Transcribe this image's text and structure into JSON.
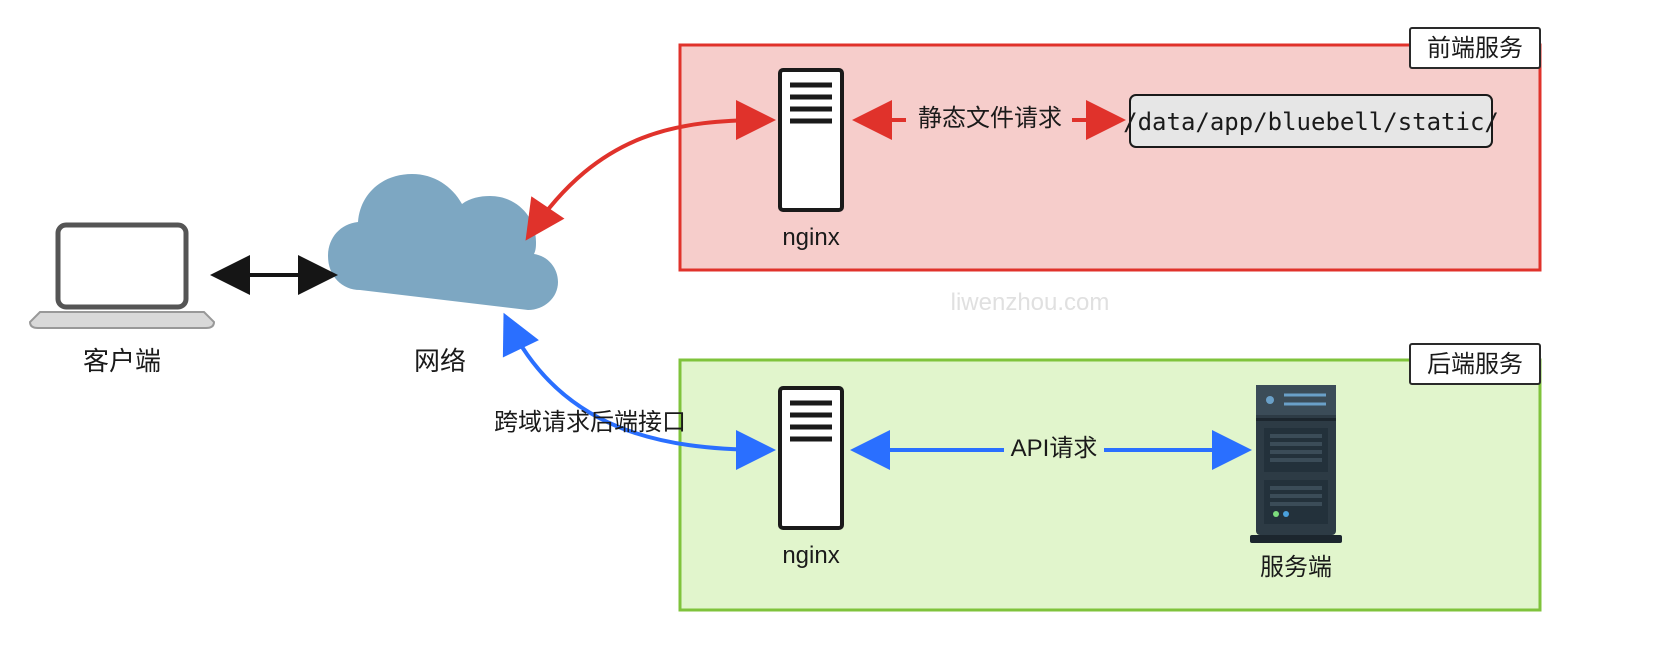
{
  "client": {
    "label": "客户端"
  },
  "network": {
    "label": "网络"
  },
  "frontend": {
    "group_label": "前端服务",
    "nginx_label": "nginx",
    "static_path": "/data/app/bluebell/static/",
    "edge_label": "静态文件请求"
  },
  "backend": {
    "group_label": "后端服务",
    "nginx_label": "nginx",
    "server_label": "服务端",
    "edge_label": "API请求",
    "cross_label": "跨域请求后端接口"
  },
  "watermark": "liwenzhou.com",
  "colors": {
    "red": "#e0322b",
    "blue": "#2a6fff",
    "black": "#151515",
    "front_fill": "#f6cdcb",
    "front_stroke": "#e0322b",
    "back_fill": "#e1f5cc",
    "back_stroke": "#7fc33b",
    "cloud": "#7da7c2"
  }
}
